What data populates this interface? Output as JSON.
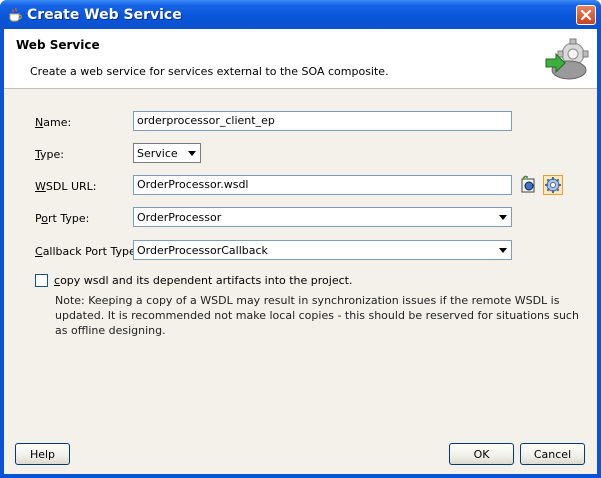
{
  "window": {
    "title": "Create Web Service",
    "titlebar_color": "#0a53d6",
    "app_icon": "oracle-cup-icon",
    "close_icon": "close-icon"
  },
  "header": {
    "title": "Web Service",
    "description": "Create a web service for services external to the SOA composite.",
    "icon": "web-service-gear-icon"
  },
  "form": {
    "name": {
      "accel": "N",
      "label_rest": "ame:",
      "value": "orderprocessor_client_ep"
    },
    "type": {
      "accel": "T",
      "label_rest": "ype:",
      "value": "Service"
    },
    "wsdl": {
      "accel": "W",
      "label_rest": "SDL URL:",
      "value": "OrderProcessor.wsdl",
      "browse_icon": "find-wsdl-icon",
      "generate_icon": "generate-wsdl-gear-icon"
    },
    "port_type": {
      "label_pre": "P",
      "accel": "o",
      "label_rest": "rt Type:",
      "value": "OrderProcessor"
    },
    "callback_port_type": {
      "accel": "C",
      "label_rest": "allback Port Type:",
      "value": "OrderProcessorCallback"
    },
    "copy_wsdl": {
      "accel": "c",
      "label_rest": "opy wsdl and its dependent artifacts into the project.",
      "checked": false
    }
  },
  "note": "Note: Keeping a copy of a WSDL may result in synchronization issues if the remote WSDL is updated. It is recommended not make local copies - this should be reserved for situations such as offline designing.",
  "footer": {
    "help_label": "Help",
    "ok_label": "OK",
    "cancel_label": "Cancel"
  }
}
